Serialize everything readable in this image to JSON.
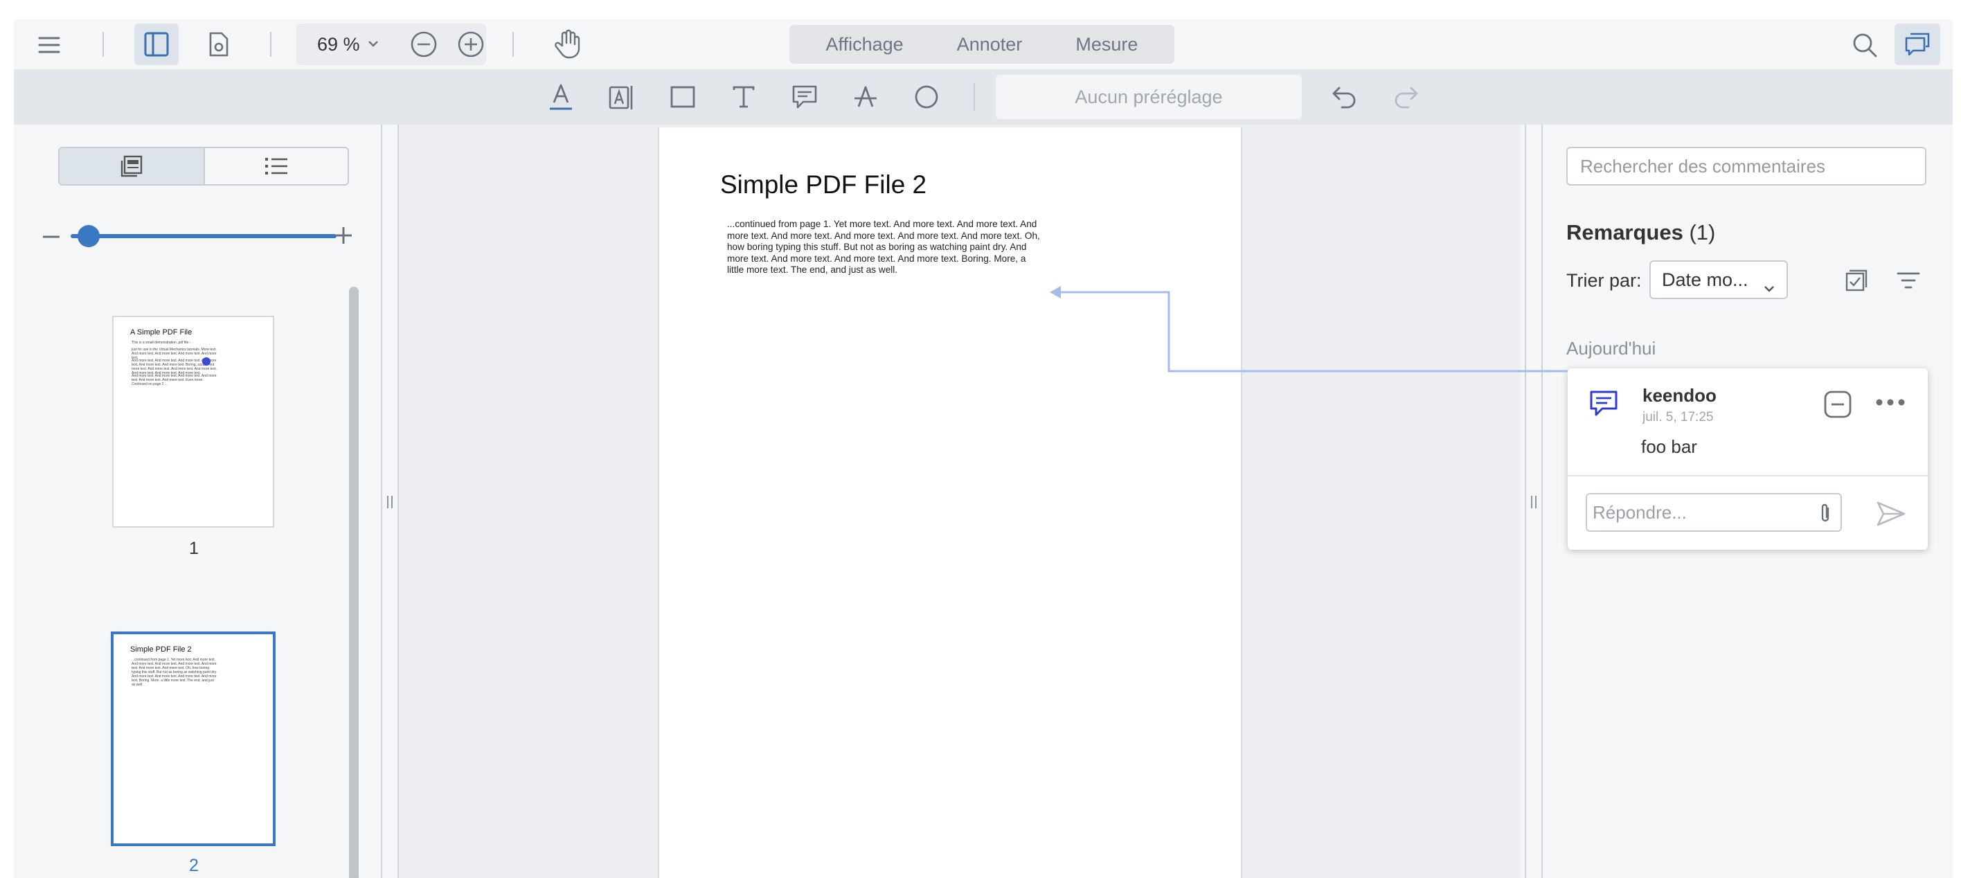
{
  "header": {
    "zoom_value": "69 %",
    "mode_tabs": [
      "Affichage",
      "Annoter",
      "Mesure"
    ]
  },
  "toolbar": {
    "preset_label": "Aucun préréglage",
    "tools": [
      "underline-icon",
      "free-text-icon",
      "rectangle-icon",
      "text-icon",
      "comment-icon",
      "strikeout-icon",
      "ellipse-icon"
    ]
  },
  "thumbnails": {
    "pages": [
      {
        "label": "1",
        "title": "A Simple PDF File",
        "lines": [
          "This is a small demonstration .pdf file -",
          "just for use in the Virtual Mechanics tutorials. More text. And more text. And more text. And more text. And more text.",
          "And more text. And more text. And more text. And more text. And more text. And more text. Boring, zzzzz. And more text. And more text. And more text. And more text. And more text. And more text. And more text.",
          "And more text. And more text. And more text. And more text. And more text. And more text. Even more. Continued on page 2 ..."
        ]
      },
      {
        "label": "2",
        "title": "Simple PDF File 2",
        "lines": [
          "...continued from page 1. Yet more text. And more text. And more text. And more text. And more text. And more text. And more text. And more text. Oh, how boring typing this stuff. But not as boring as watching paint dry. And more text. And more text. And more text. And more text. Boring. More, a little more text. The end, and just as well."
        ]
      }
    ]
  },
  "document": {
    "title": "Simple PDF File 2",
    "body": "...continued from page 1. Yet more text. And more text. And more text. And more text. And more text. And more text. And more text. And more text. Oh, how boring typing this stuff. But not as boring as watching paint dry. And more text. And more text. And more text. And more text. Boring.  More, a little more text. The end, and just as well."
  },
  "notes": {
    "search_placeholder": "Rechercher des commentaires",
    "heading": "Remarques",
    "count": "(1)",
    "sort_label": "Trier par:",
    "sort_value": "Date mo...",
    "day": "Aujourd'hui",
    "items": [
      {
        "author": "keendoo",
        "time": "juil. 5, 17:25",
        "text": "foo bar",
        "reply_placeholder": "Répondre..."
      }
    ]
  },
  "colors": {
    "accent": "#3a78c4",
    "note_icon": "#2f3ad1",
    "leader_line": "#a4bde8"
  }
}
